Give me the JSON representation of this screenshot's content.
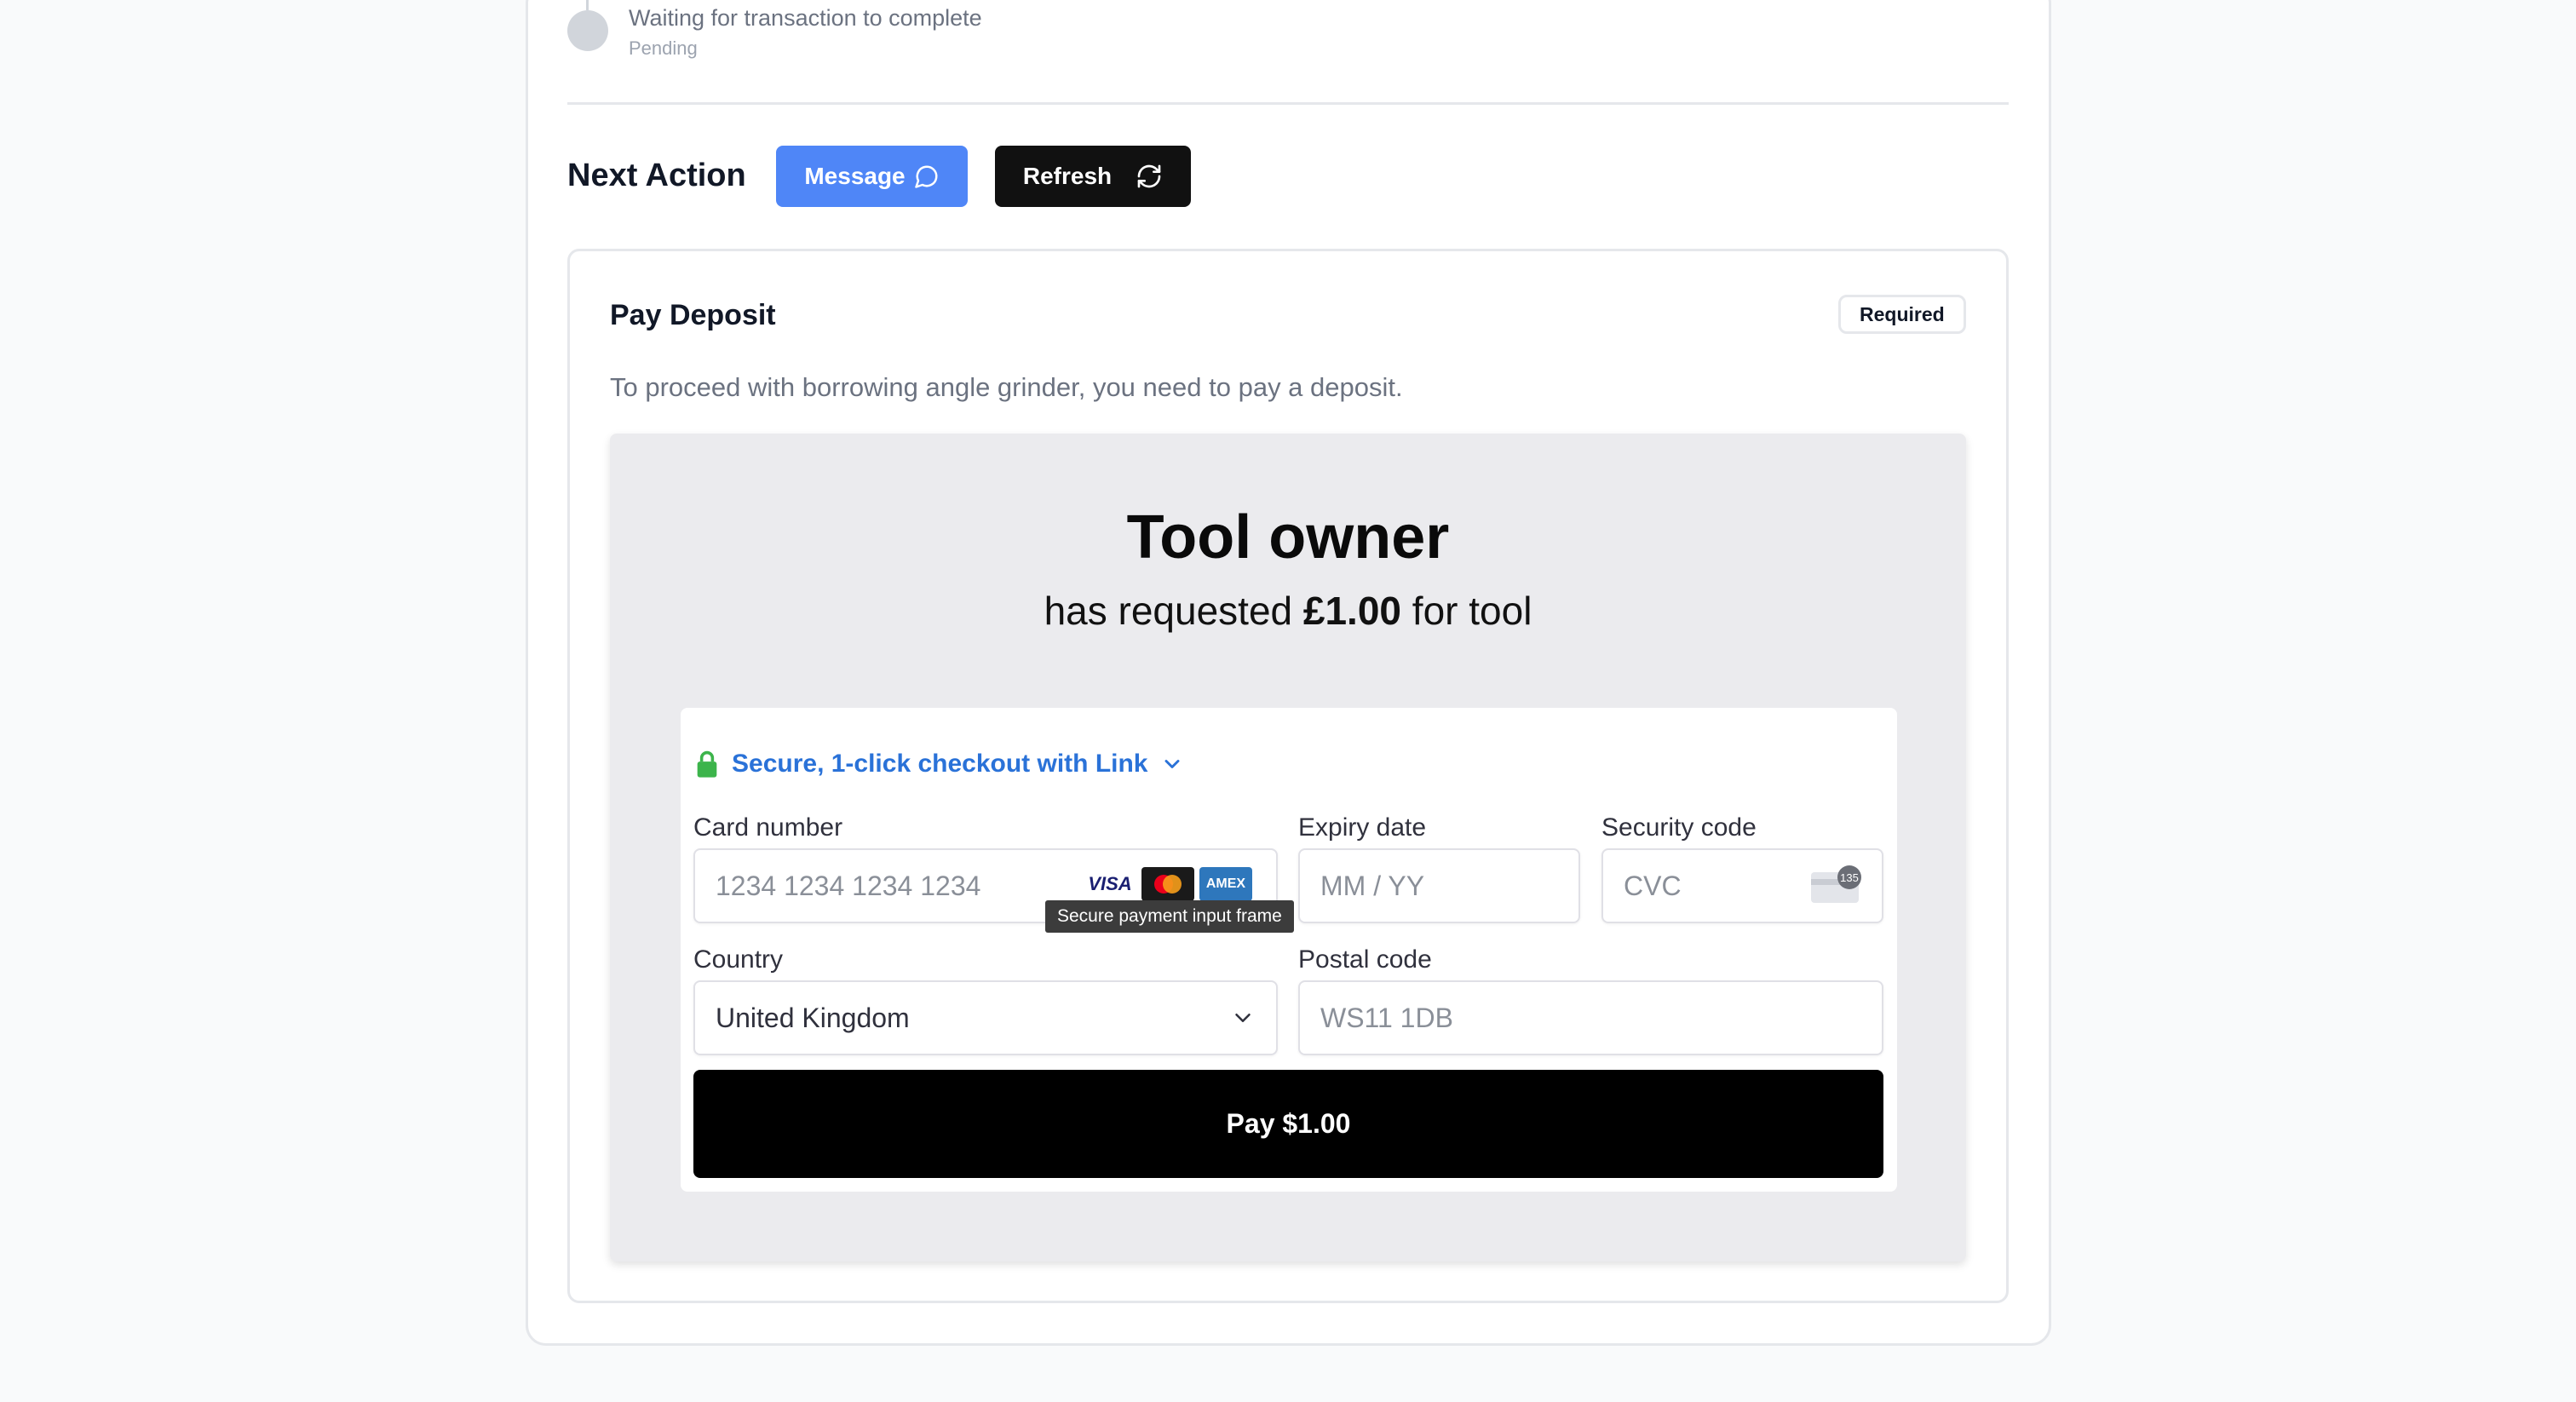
{
  "timeline": {
    "step_title": "Waiting for transaction to complete",
    "step_status": "Pending"
  },
  "next_action": {
    "title": "Next Action",
    "message_label": "Message",
    "refresh_label": "Refresh"
  },
  "deposit": {
    "title": "Pay Deposit",
    "badge": "Required",
    "description": "To proceed with borrowing angle grinder, you need to pay a deposit."
  },
  "payment": {
    "heading": "Tool owner",
    "requested_prefix": "has requested ",
    "requested_amount": "£1.00",
    "requested_suffix": " for tool",
    "link_text": "Secure, 1-click checkout with Link",
    "card_number_label": "Card number",
    "card_number_placeholder": "1234 1234 1234 1234",
    "expiry_label": "Expiry date",
    "expiry_placeholder": "MM / YY",
    "security_label": "Security code",
    "security_placeholder": "CVC",
    "cvc_digits": "135",
    "card_brands": [
      "VISA",
      "mastercard",
      "AMEX"
    ],
    "tooltip": "Secure payment input frame",
    "country_label": "Country",
    "country_value": "United Kingdom",
    "postal_label": "Postal code",
    "postal_placeholder": "WS11 1DB",
    "pay_button": "Pay $1.00"
  },
  "colors": {
    "accent": "#4f86f7",
    "link": "#2a72d8",
    "lock": "#3cb44b",
    "pay_button": "#000000"
  }
}
